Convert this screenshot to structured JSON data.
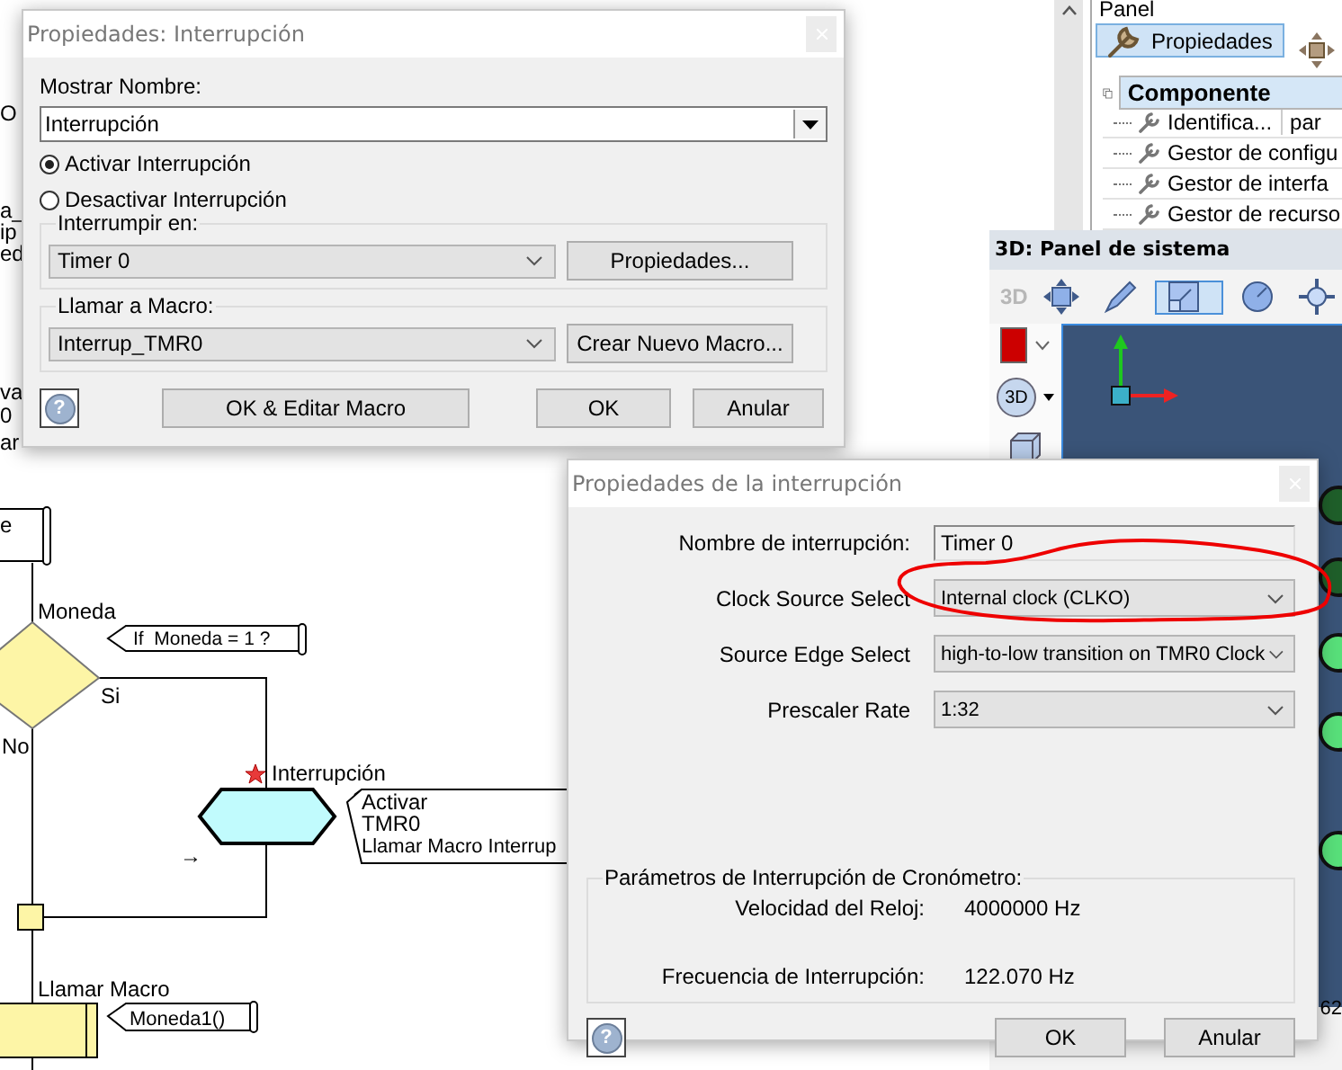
{
  "background_fragments": [
    "O",
    "a_",
    "ip",
    "ed",
    "va",
    "0",
    "ar"
  ],
  "flowchart": {
    "top_box_text": "e",
    "decision": {
      "label": "Moneda",
      "comment": "If  Moneda = 1 ?",
      "yes_label": "Si",
      "no_label": "No"
    },
    "interrupt": {
      "label": "Interrupción",
      "comment_lines": [
        "Activar",
        "TMR0",
        "Llamar Macro Interrup"
      ]
    },
    "arrow": "→",
    "call": {
      "label": "Llamar Macro",
      "comment": "Moneda1()"
    }
  },
  "panel": {
    "title": "Panel",
    "tabs": [
      {
        "kind": "properties",
        "label": "Propiedades",
        "selected": true
      },
      {
        "kind": "position",
        "selected": false
      }
    ],
    "tree": {
      "label": "Componente",
      "selected": true,
      "children": [
        {
          "label": "Identifica...",
          "value": "par"
        },
        {
          "label": "Gestor de configu"
        },
        {
          "label": "Gestor de interfa"
        },
        {
          "label": "Gestor de recurso"
        }
      ]
    }
  },
  "system_panel": {
    "title": "3D: Panel de sistema",
    "toolbar": [
      {
        "kind": "text",
        "label": "3D",
        "selected": false,
        "disabled": true
      },
      {
        "kind": "move",
        "selected": false
      },
      {
        "kind": "pencil",
        "selected": false
      },
      {
        "kind": "resize",
        "selected": true
      },
      {
        "kind": "rotate",
        "selected": false
      },
      {
        "kind": "target",
        "selected": false
      }
    ],
    "view_button": "3D",
    "leds": [
      {
        "on": false
      },
      {
        "on": false
      },
      {
        "on": true
      },
      {
        "on": true
      },
      {
        "on": true
      }
    ],
    "coordinate": "62"
  },
  "interrupt_dialog": {
    "title": "Propiedades: Interrupción",
    "name_label": "Mostrar Nombre:",
    "name_value": "Interrupción",
    "radios": [
      {
        "label": "Activar Interrupción",
        "selected": true
      },
      {
        "label": "Desactivar Interrupción",
        "selected": false
      }
    ],
    "groups": [
      {
        "legend": "Interrumpir en:",
        "value": "Timer 0",
        "button": "Propiedades..."
      },
      {
        "legend": "Llamar a Macro:",
        "value": "Interrup_TMR0",
        "button": "Crear Nuevo Macro..."
      }
    ],
    "help": "?",
    "buttons": [
      "OK & Editar Macro",
      "OK",
      "Anular"
    ]
  },
  "properties_dialog": {
    "title": "Propiedades de la interrupción",
    "fields": [
      {
        "label": "Nombre de interrupción:",
        "kind": "text",
        "value": "Timer 0"
      },
      {
        "label": "Clock Source Select",
        "kind": "select",
        "value": "Internal clock (CLKO)"
      },
      {
        "label": "Source Edge Select",
        "kind": "select",
        "value": "high-to-low transition on TMR0 Clock"
      },
      {
        "label": "Prescaler Rate",
        "kind": "select",
        "value": "1:32"
      }
    ],
    "group": {
      "legend": "Parámetros de Interrupción de Cronómetro:",
      "rows": [
        {
          "label": "Velocidad del Reloj:",
          "value": "4000000 Hz"
        },
        {
          "label": "Frecuencia de Interrupción:",
          "value": "122.070 Hz"
        }
      ]
    },
    "help": "?",
    "buttons": [
      "OK",
      "Anular"
    ]
  }
}
